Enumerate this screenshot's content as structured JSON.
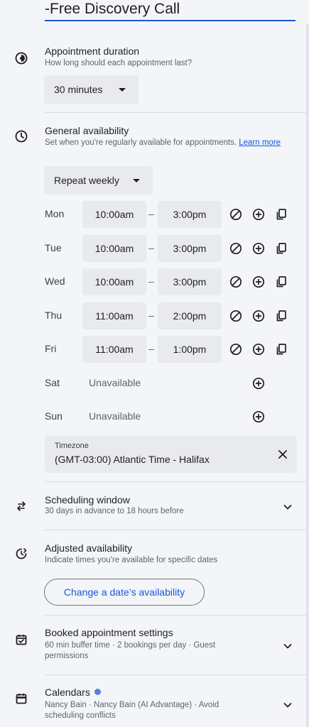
{
  "title": "-Free Discovery Call",
  "duration": {
    "title": "Appointment duration",
    "subtitle": "How long should each appointment last?",
    "value": "30 minutes"
  },
  "availability": {
    "title": "General availability",
    "subtitle": "Set when you're regularly available for appointments.",
    "learn_more": "Learn more",
    "repeat": "Repeat weekly",
    "dash": "–",
    "days": [
      {
        "label": "Mon",
        "start": "10:00am",
        "end": "3:00pm"
      },
      {
        "label": "Tue",
        "start": "10:00am",
        "end": "3:00pm"
      },
      {
        "label": "Wed",
        "start": "10:00am",
        "end": "3:00pm"
      },
      {
        "label": "Thu",
        "start": "11:00am",
        "end": "2:00pm"
      },
      {
        "label": "Fri",
        "start": "11:00am",
        "end": "1:00pm"
      },
      {
        "label": "Sat",
        "status": "Unavailable"
      },
      {
        "label": "Sun",
        "status": "Unavailable"
      }
    ],
    "timezone_label": "Timezone",
    "timezone": "(GMT-03:00) Atlantic Time - Halifax"
  },
  "scheduling": {
    "title": "Scheduling window",
    "subtitle": "30 days in advance to 18 hours before"
  },
  "adjusted": {
    "title": "Adjusted availability",
    "subtitle": "Indicate times you're available for specific dates",
    "button": "Change a date’s availability"
  },
  "booked": {
    "title": "Booked appointment settings",
    "subtitle_1": "60 min buffer time · 2 bookings per day · Guest",
    "subtitle_2": "permissions"
  },
  "calendars": {
    "title": "Calendars",
    "subtitle_1": "Nancy Bain · Nancy Bain (AI Advantage) · Avoid",
    "subtitle_2": "scheduling conflicts"
  },
  "colors": {
    "accent": "#1a56d8",
    "background": "#f3f5f9",
    "field": "#e8eaee",
    "calendar_dot": "#5b7fe0"
  },
  "icons": [
    "duration-icon",
    "clock-icon",
    "swap-icon",
    "clock-adjust-icon",
    "calendar-check-icon",
    "calendar-icon",
    "block-icon",
    "add-circle-icon",
    "copy-icon",
    "close-icon",
    "chevron-down-icon"
  ]
}
